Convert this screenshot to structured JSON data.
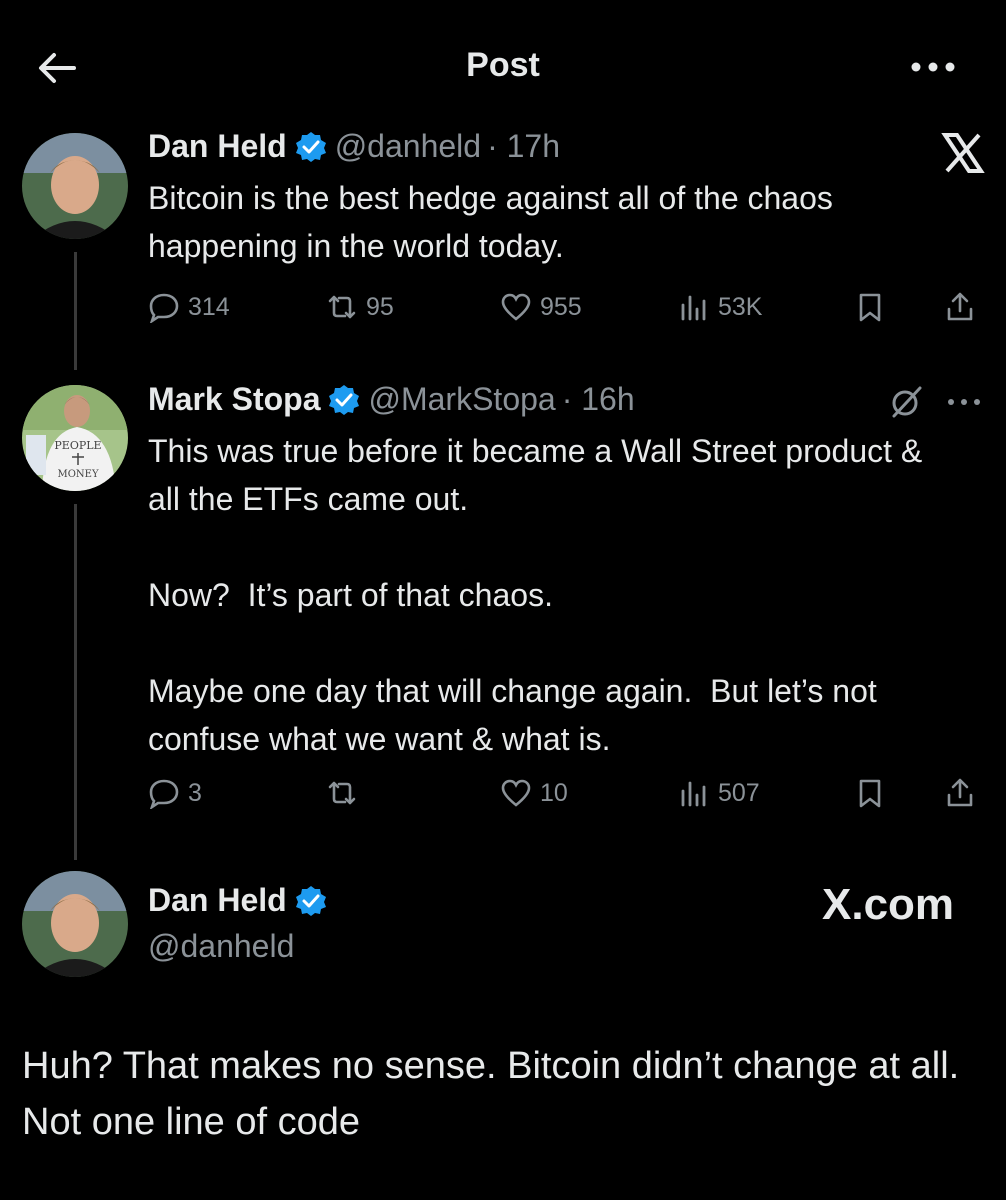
{
  "header": {
    "title": "Post"
  },
  "tweets": [
    {
      "name": "Dan Held",
      "handle": "@danheld",
      "time": "· 17h",
      "text": "Bitcoin is the best hedge against all of the chaos happening in the world today.",
      "stats": {
        "replies": "314",
        "reposts": "95",
        "likes": "955",
        "views": "53K"
      }
    },
    {
      "name": "Mark Stopa",
      "handle": "@MarkStopa",
      "time": "· 16h",
      "text": "This was true before it became a Wall Street product & all the ETFs came out.\n\nNow?  It’s part of that chaos.\n\nMaybe one day that will change again.  But let’s not confuse what we want & what is.",
      "stats": {
        "replies": "3",
        "reposts": "",
        "likes": "10",
        "views": "507"
      },
      "avatar_text": {
        "line1": "PEOPLE",
        "line2": "MONEY"
      }
    }
  ],
  "reply": {
    "name": "Dan Held",
    "handle": "@danheld",
    "brand": "X.com",
    "text": "Huh? That makes no sense. Bitcoin didn’t change at all. Not one line of code"
  },
  "colors": {
    "background": "#000000",
    "text": "#e7e9ea",
    "muted": "#8b9298",
    "verified": "#1d9bf0"
  },
  "icons": [
    "back-arrow-icon",
    "more-icon",
    "x-logo-icon",
    "verified-icon",
    "reply-icon",
    "repost-icon",
    "like-icon",
    "views-icon",
    "bookmark-icon",
    "share-icon",
    "grok-icon"
  ]
}
